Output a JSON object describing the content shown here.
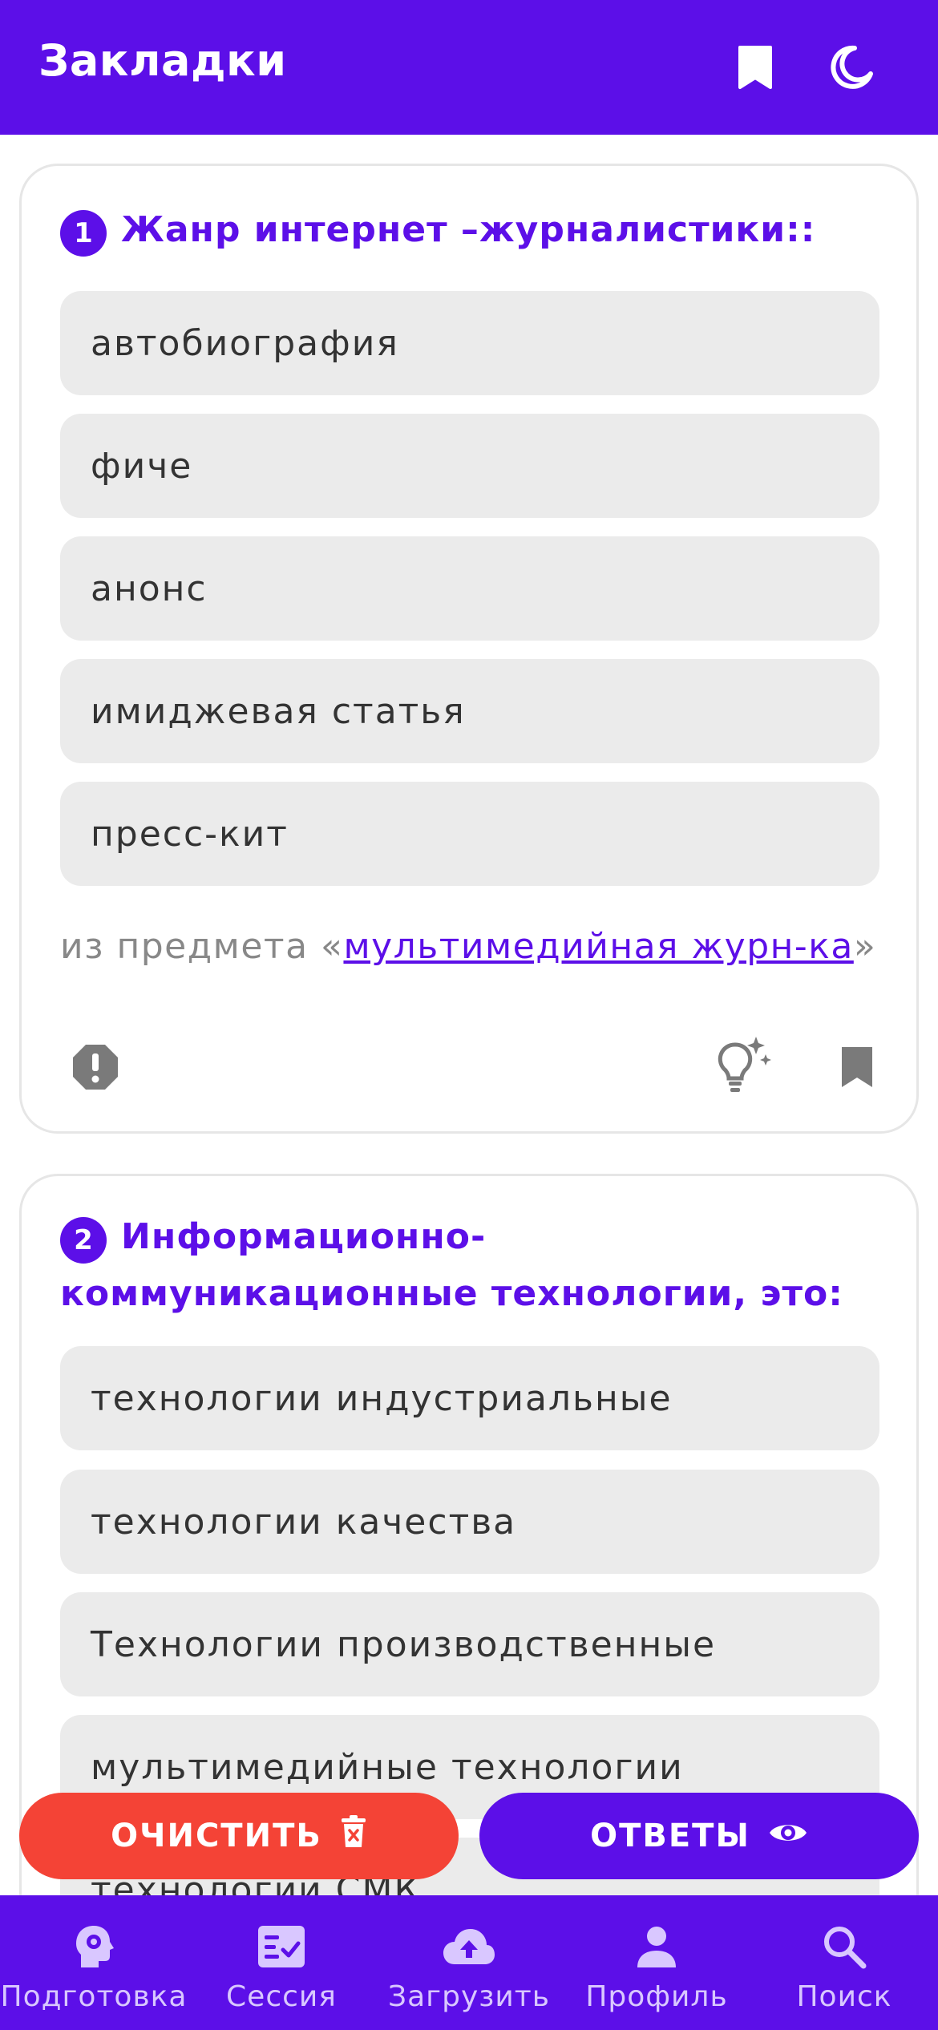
{
  "header": {
    "title": "Закладки",
    "bookmark_icon": "bookmark-icon",
    "theme_icon": "moon-icon"
  },
  "questions": [
    {
      "number": "1",
      "text": "Жанр интернет –журналистики::",
      "options": [
        "автобиография",
        "фиче",
        "анонс",
        "имиджевая статья",
        "пресс-кит"
      ],
      "subject_prefix": "из предмета «",
      "subject_link": "мультимедийная журн-ка",
      "subject_suffix": "»",
      "icons": [
        "report-icon",
        "hint-icon",
        "bookmark-icon"
      ]
    },
    {
      "number": "2",
      "text_line1": "Информационно-",
      "text_line2": "коммуникационные технологии, это:",
      "options": [
        "технологии индустриальные",
        "технологии качества",
        "Технологии производственные",
        "мультимедийные технологии",
        "технологии СМК"
      ]
    }
  ],
  "actions": {
    "clear_label": "ОЧИСТИТЬ",
    "answers_label": "ОТВЕТЫ"
  },
  "nav": [
    {
      "label": "Подготовка",
      "icon": "brain-gear-icon"
    },
    {
      "label": "Сессия",
      "icon": "checklist-icon"
    },
    {
      "label": "Загрузить",
      "icon": "cloud-upload-icon"
    },
    {
      "label": "Профиль",
      "icon": "person-icon"
    },
    {
      "label": "Поиск",
      "icon": "search-icon"
    }
  ],
  "colors": {
    "primary": "#5c0fe8",
    "danger": "#f44336",
    "option_bg": "#ebebeb",
    "nav_label": "#d9c7ff"
  }
}
